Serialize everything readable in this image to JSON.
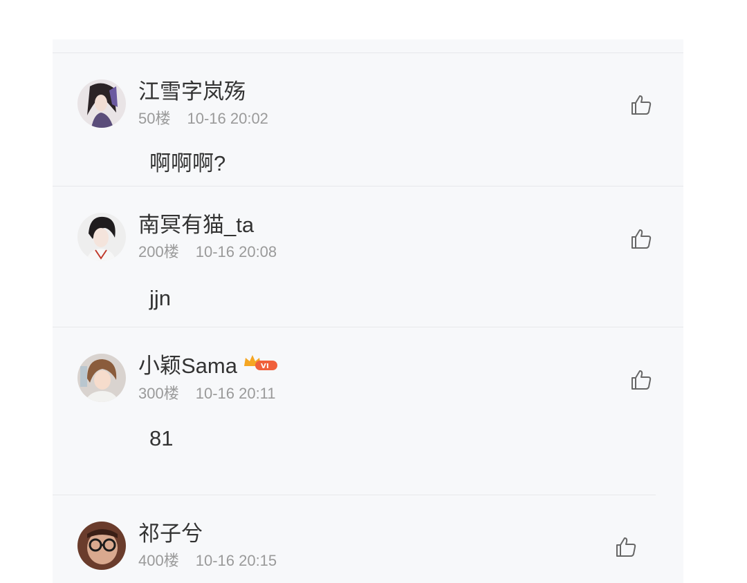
{
  "comments": [
    {
      "username": "江雪字岚殇",
      "floor": "50楼",
      "time": "10-16 20:02",
      "content": "啊啊啊?",
      "vip": false
    },
    {
      "username": "南冥有猫_ta",
      "floor": "200楼",
      "time": "10-16 20:08",
      "content": "jjn",
      "vip": false
    },
    {
      "username": "小颖Sama",
      "floor": "300楼",
      "time": "10-16 20:11",
      "content": "81",
      "vip": true
    },
    {
      "username": "祁子兮",
      "floor": "400楼",
      "time": "10-16 20:15",
      "content": "",
      "vip": false
    }
  ],
  "icons": {
    "like": "thumbs-up-icon",
    "vip_badge": "crown-vip-badge-icon"
  },
  "colors": {
    "panel": "#f7f8fa",
    "separator": "#e7e8eb",
    "text": "#333333",
    "meta": "#9a9a9a",
    "vip_gold": "#f5a623",
    "vip_red": "#f0603b"
  }
}
